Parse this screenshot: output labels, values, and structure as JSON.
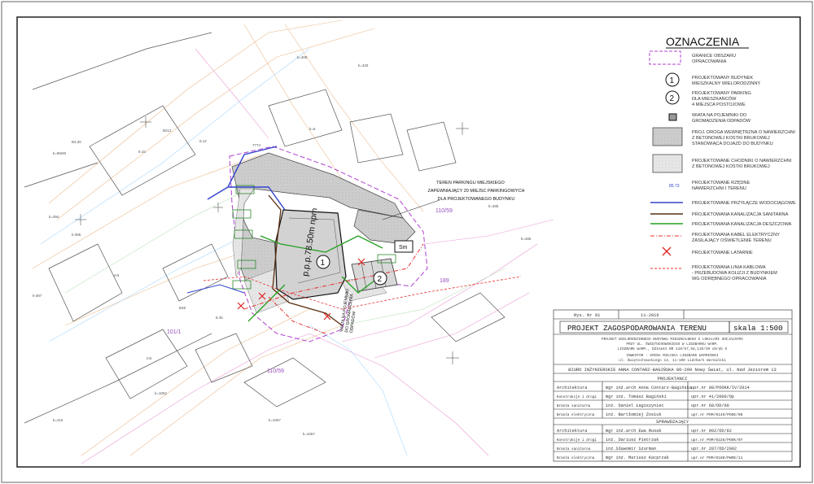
{
  "legend": {
    "title": "OZNACZENIA",
    "items": [
      {
        "lines": [
          "GRANICE OBSZARU",
          "OPRACOWANIA"
        ]
      },
      {
        "marker": "1",
        "lines": [
          "PROJEKTOWANY BUDYNEK",
          "MIESZKALNY WIELORODZINNY"
        ]
      },
      {
        "marker": "2",
        "lines": [
          "PROJEKTOWANY PARKING",
          "DLA MIESZKAŃCÓW",
          "4 MIEJSCA POSTOJOWE"
        ]
      },
      {
        "lines": [
          "WIATA NA POJEMNIKI DO",
          "GROMADZENIA ODPADÓW"
        ]
      },
      {
        "lines": [
          "PROJ. DROGA WEWNĘTRZNA O NAWIERZCHNI",
          "Z BETONOWEJ KOSTKI BRUKOWEJ",
          "STANOWIĄCA DOJAZD DO BUDYNKU"
        ]
      },
      {
        "lines": [
          "PROJEKTOWANE CHODNIKI O NAWIERZCHNI",
          "Z BETONOWEJ KOSTKI BRUKOWEJ"
        ]
      },
      {
        "marker": "85.73",
        "lines": [
          "PROJEKTOWANE RZĘDNE",
          "NAWIERZCHNI I TERENU"
        ]
      },
      {
        "lines": [
          "PROJEKTOWANE PRZYŁĄCZE WODOCIĄGOWE"
        ]
      },
      {
        "lines": [
          "PROJEKTOWANA KANALIZACJA SANITARNA"
        ]
      },
      {
        "lines": [
          "PROJEKTOWANA KANALIZACJA DESZCZOWA"
        ]
      },
      {
        "lines": [
          "PROJEKTOWANA KABEL ELEKTRYCZNY",
          "ZASILAJĄCY OŚWIETLENIE TERENU"
        ]
      },
      {
        "lines": [
          "PROJEKTOWANE LATARNIE"
        ]
      },
      {
        "lines": [
          "PROJEKTOWANA LINIA KABLOWA",
          "- PRZEBUDOWA KOLIZJI Z BUDYNKIEM",
          "WG ODRĘBNEGO OPRACOWANIA"
        ]
      }
    ]
  },
  "map": {
    "parking_note": [
      "TEREN PARKINGU MIEJSKIEGO",
      "ZAPEWNIAJĄCY 20 MIEJSC PARKINGOWYCH",
      "DLA PROJEKTOWANEGO BUDYNKU"
    ],
    "building_label": "p.p.p.78.50m npm",
    "building_marker": "1",
    "parking_marker": "2",
    "bin_label": "Sm",
    "parcel_110_59": "110/59",
    "parcel_110_59b": "110/59",
    "parcel_101_1": "101/1",
    "parcel_189": "189",
    "side_text": [
      "WIATA NA POJEMNIKI",
      "DO GROMADZENIA",
      "ODPADÓW"
    ]
  },
  "title_block": {
    "sheet_no": "Rys. Nr 01",
    "date": "11-2016",
    "title": "PROJEKT ZAGOSPODAROWANIA TERENU",
    "scale": "skala 1:500",
    "desc": [
      "PROJEKT WIELORODZINNEGO BUDYNKU MIESZKALNEGO Z LOKALAMI SOCJALNYMI",
      "PRZY UL. ŚWIĘTOCHOWSKIEGO W LIDZBARKU WARM.",
      "LIDZBARK WARM., DZIAŁKI NR 110/57,58,110/39 obręb 6"
    ],
    "investor": [
      "INWESTOR : GMINA MIEJSKA LIDZBARK WARMIŃSKI",
      "ul. Świętochowskiego 14, 11-100 Lidzbark Warmiński"
    ],
    "office": "BIURO INŻYNIERSKIE ANNA CONTARZ-BAGIŃSKA 80-299 Nowy Świat, ul. Nad Jeziorem 13",
    "designers_header": "PROJEKTANCI",
    "designers": [
      {
        "role": "Architektura",
        "name": "mgr inż.arch Anna Contarz-Bagińska",
        "perm": "upr.nr 08/POOKK/IV/2014"
      },
      {
        "role": "Konstrukcje i drogi",
        "name": "mgr inż. Tomasz Bagiński",
        "perm": "upr.nr 41/2000/Op"
      },
      {
        "role": "Branża sanitarna",
        "name": "inż. Daniel Łagiszyniec",
        "perm": "upr.nr 68/OD/00"
      },
      {
        "role": "Branża elektryczna",
        "name": "inż. Bartłomiej Zosiuk",
        "perm": "upr.nr POM/0149/POOE/06"
      }
    ],
    "checkers_header": "SPRAWDZAJĄCY",
    "checkers": [
      {
        "role": "Architektura",
        "name": "mgr inż.arch Ewa Rusak",
        "perm": "upr.nr 902/OD/82"
      },
      {
        "role": "Konstrukcje i drogi",
        "name": "inż. Dariusz Pietrzak",
        "perm": "upr.nr POM/0226/POOK/07"
      },
      {
        "role": "Branża sanitarna",
        "name": "inż.Sławomir Szurman",
        "perm": "upr.nr 287/OD/2002"
      },
      {
        "role": "Branża elektryczna",
        "name": "mgr inż. Mariusz Kacprzak",
        "perm": "upr.nr POM/0189/PWOE/11"
      }
    ]
  },
  "colors": {
    "road": "#c9c9c9",
    "water": "#3344cc",
    "sanitary": "#5a2e10",
    "storm": "#22a022",
    "power": "#e83030",
    "boundary": "#b040d0",
    "contour_orange": "#e8a060",
    "contour_pink": "#e070c0"
  }
}
